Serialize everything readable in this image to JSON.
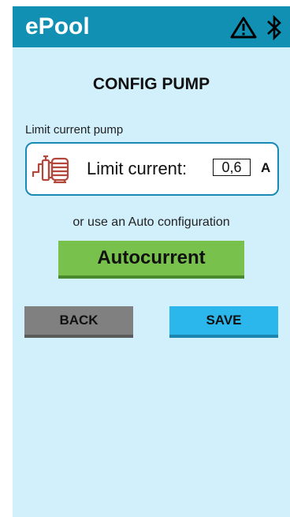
{
  "header": {
    "title": "ePool",
    "icons": [
      "warning-icon",
      "bluetooth-icon"
    ],
    "background": "#1190b3"
  },
  "page": {
    "title": "CONFIG PUMP",
    "background": "#d2f0fc"
  },
  "limit_section": {
    "label": "Limit current pump",
    "icon": "pump-icon",
    "field_label": "Limit current:",
    "value": "0,6",
    "unit": "A"
  },
  "auto_section": {
    "label": "or use an Auto configuration",
    "button_label": "Autocurrent",
    "button_color": "#77c14c"
  },
  "actions": {
    "back_label": "BACK",
    "back_color": "#808080",
    "save_label": "SAVE",
    "save_color": "#2bb7ec"
  }
}
